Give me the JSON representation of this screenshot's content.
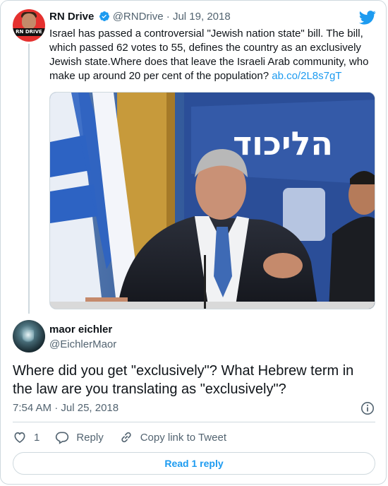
{
  "tweet": {
    "author_name": "RN Drive",
    "author_handle": "@RNDrive",
    "separator": "·",
    "date": "Jul 19, 2018",
    "avatar_text": "RN DRIVE",
    "text": "Israel has passed a controversial \"Jewish nation state\" bill. The bill, which passed 62 votes to 55, defines the country as an exclusively Jewish state.Where does that leave the Israeli Arab community, who make up around 20 per cent of the population? ",
    "link": "ab.co/2L8s7gT",
    "media_sign_text": "הליכוד"
  },
  "reply": {
    "author_name": "maor eichler",
    "author_handle": "@EichlerMaor",
    "text": "Where did you get \"exclusively\"? What Hebrew term in the law are you translating as \"exclusively\"?",
    "time": "7:54 AM",
    "separator": "·",
    "date": "Jul 25, 2018",
    "like_count": "1",
    "reply_label": "Reply",
    "copy_link_label": "Copy link to Tweet",
    "read_replies_label": "Read 1 reply"
  },
  "colors": {
    "accent": "#1d9bf0",
    "text": "#0f1419",
    "muted": "#536471",
    "border": "#cfd9de"
  },
  "icons": [
    "verified-badge-icon",
    "twitter-bird-icon",
    "info-icon",
    "heart-icon",
    "reply-bubble-icon",
    "link-icon"
  ]
}
